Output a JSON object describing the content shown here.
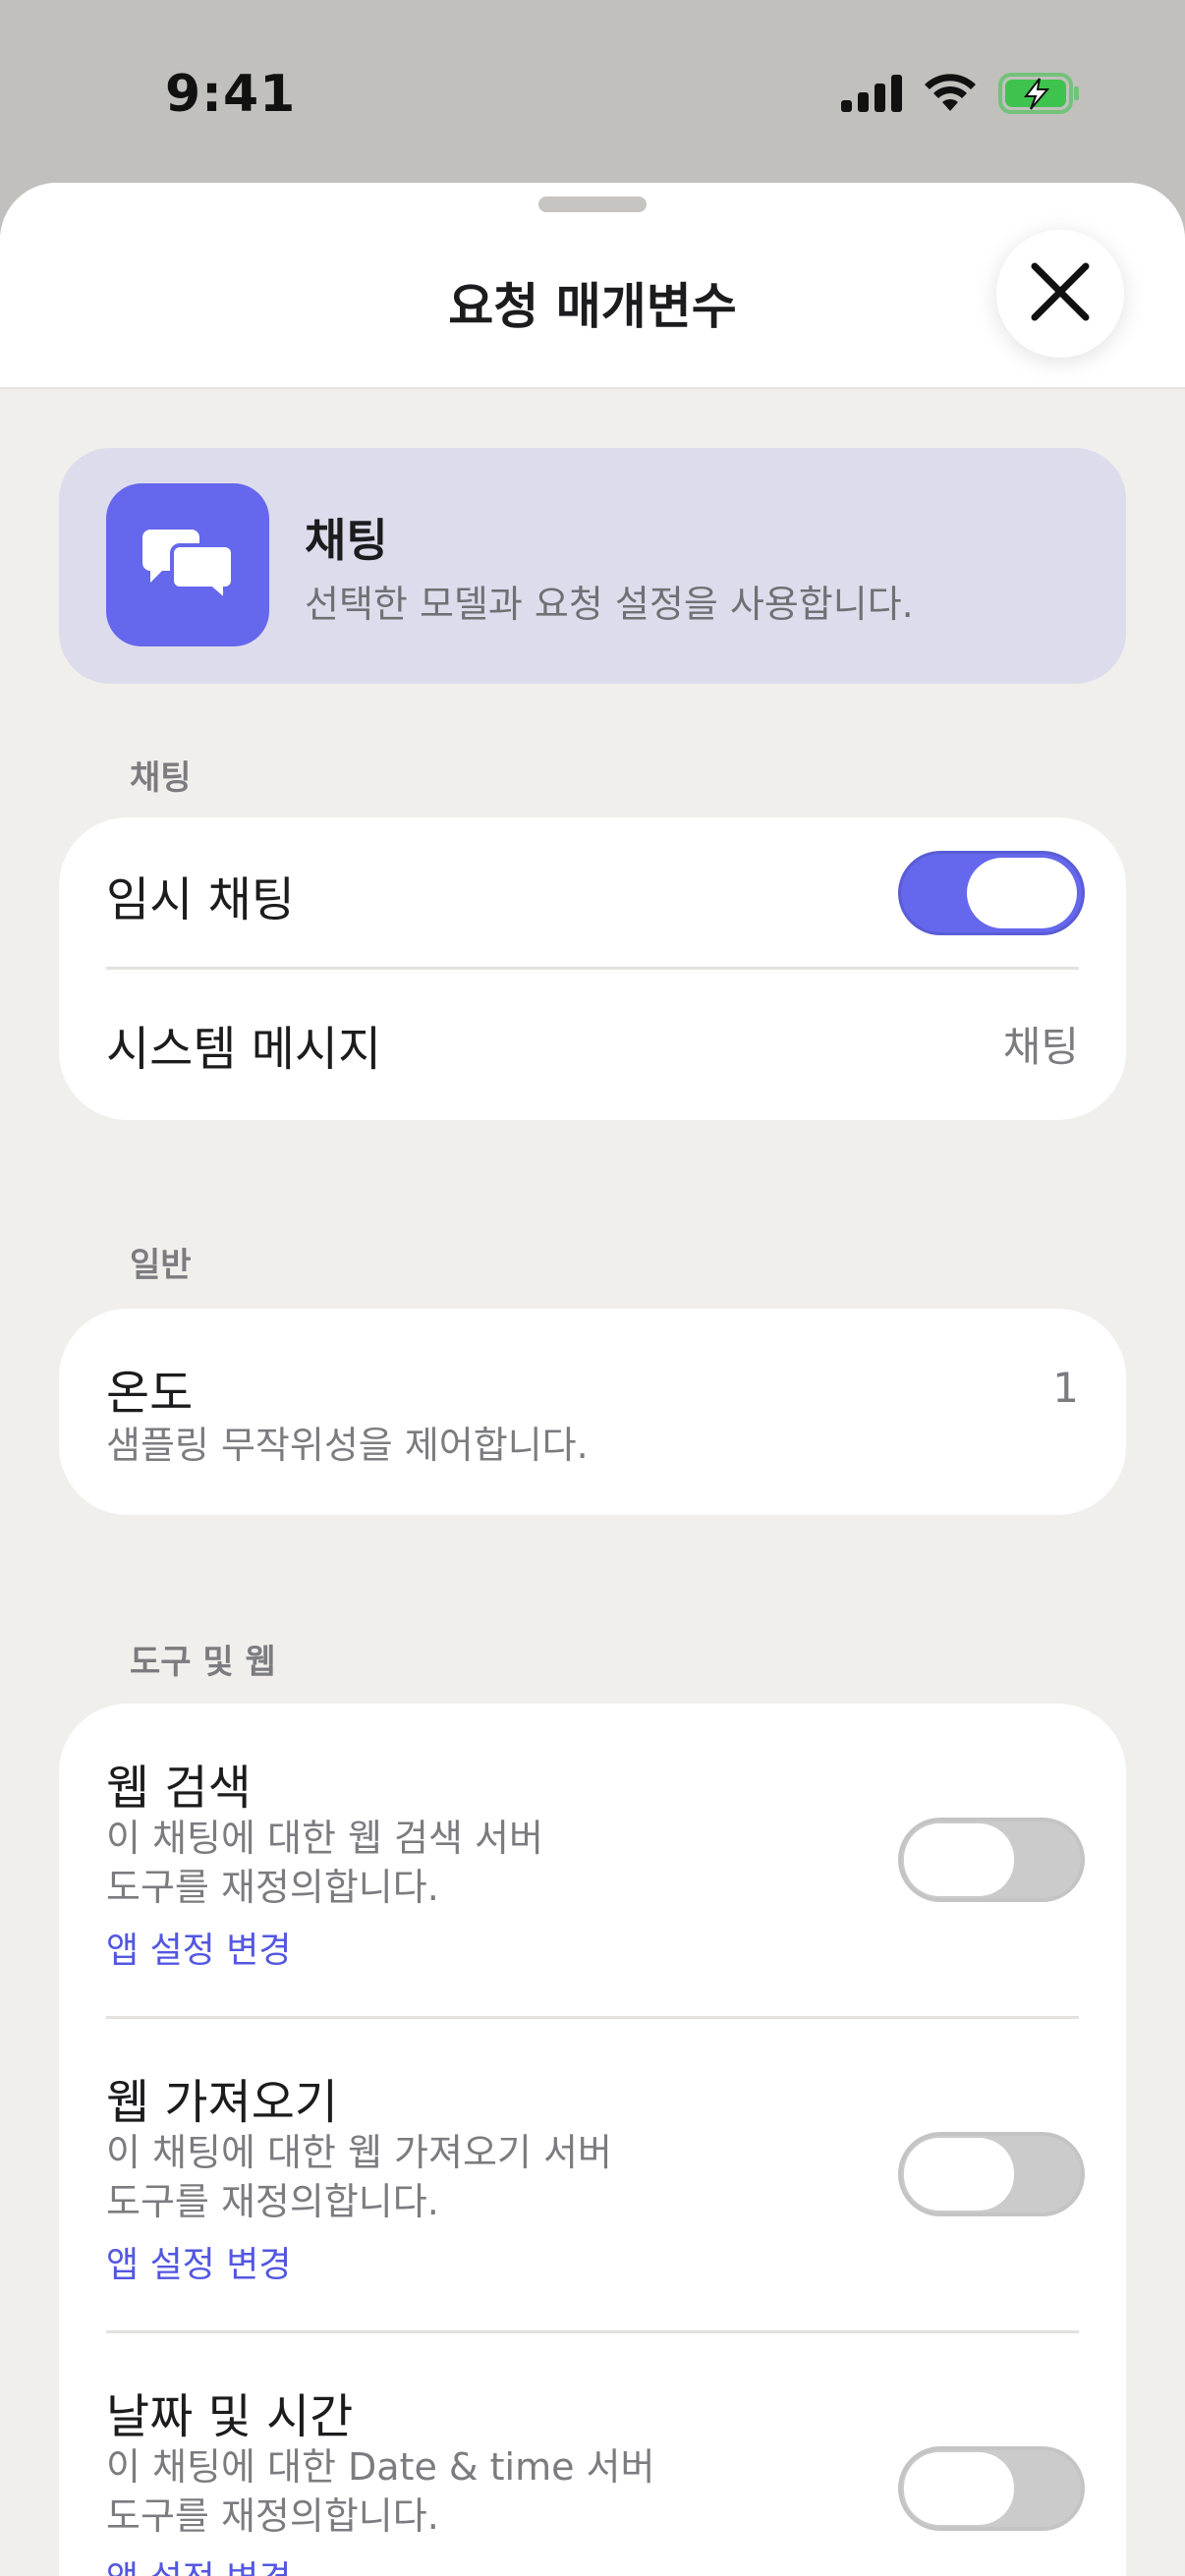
{
  "status_bar": {
    "time": "9:41",
    "icons": [
      "cellular-signal-icon",
      "wifi-icon",
      "battery-charging-icon"
    ],
    "battery_color": "#3ec34e"
  },
  "sheet": {
    "title": "요청 매개변수",
    "close_icon": "close-icon"
  },
  "mode": {
    "title": "채팅",
    "description": "선택한 모델과 요청 설정을 사용합니다.",
    "icon": "chat-bubbles-icon",
    "accent": "#6567ec"
  },
  "sections": {
    "chat": {
      "label": "채팅",
      "temp_chat": {
        "label": "임시 채팅",
        "enabled": true
      },
      "system_message": {
        "label": "시스템 메시지",
        "value": "채팅"
      }
    },
    "general": {
      "label": "일반",
      "temperature": {
        "label": "온도",
        "description": "샘플링 무작위성을 제어합니다.",
        "value": "1"
      }
    },
    "tools": {
      "label": "도구 및 웹",
      "items": [
        {
          "title": "웹 검색",
          "desc_line1": "이 채팅에 대한 웹 검색 서버",
          "desc_line2": "도구를 재정의합니다.",
          "link": "앱 설정 변경",
          "enabled": false
        },
        {
          "title": "웹 가져오기",
          "desc_line1": "이 채팅에 대한 웹 가져오기 서버",
          "desc_line2": "도구를 재정의합니다.",
          "link": "앱 설정 변경",
          "enabled": false
        },
        {
          "title": "날짜 및 시간",
          "desc_line1": "이 채팅에 대한 Date & time 서버",
          "desc_line2": "도구를 재정의합니다.",
          "link": "앱 설정 변경",
          "enabled": false
        }
      ]
    }
  }
}
